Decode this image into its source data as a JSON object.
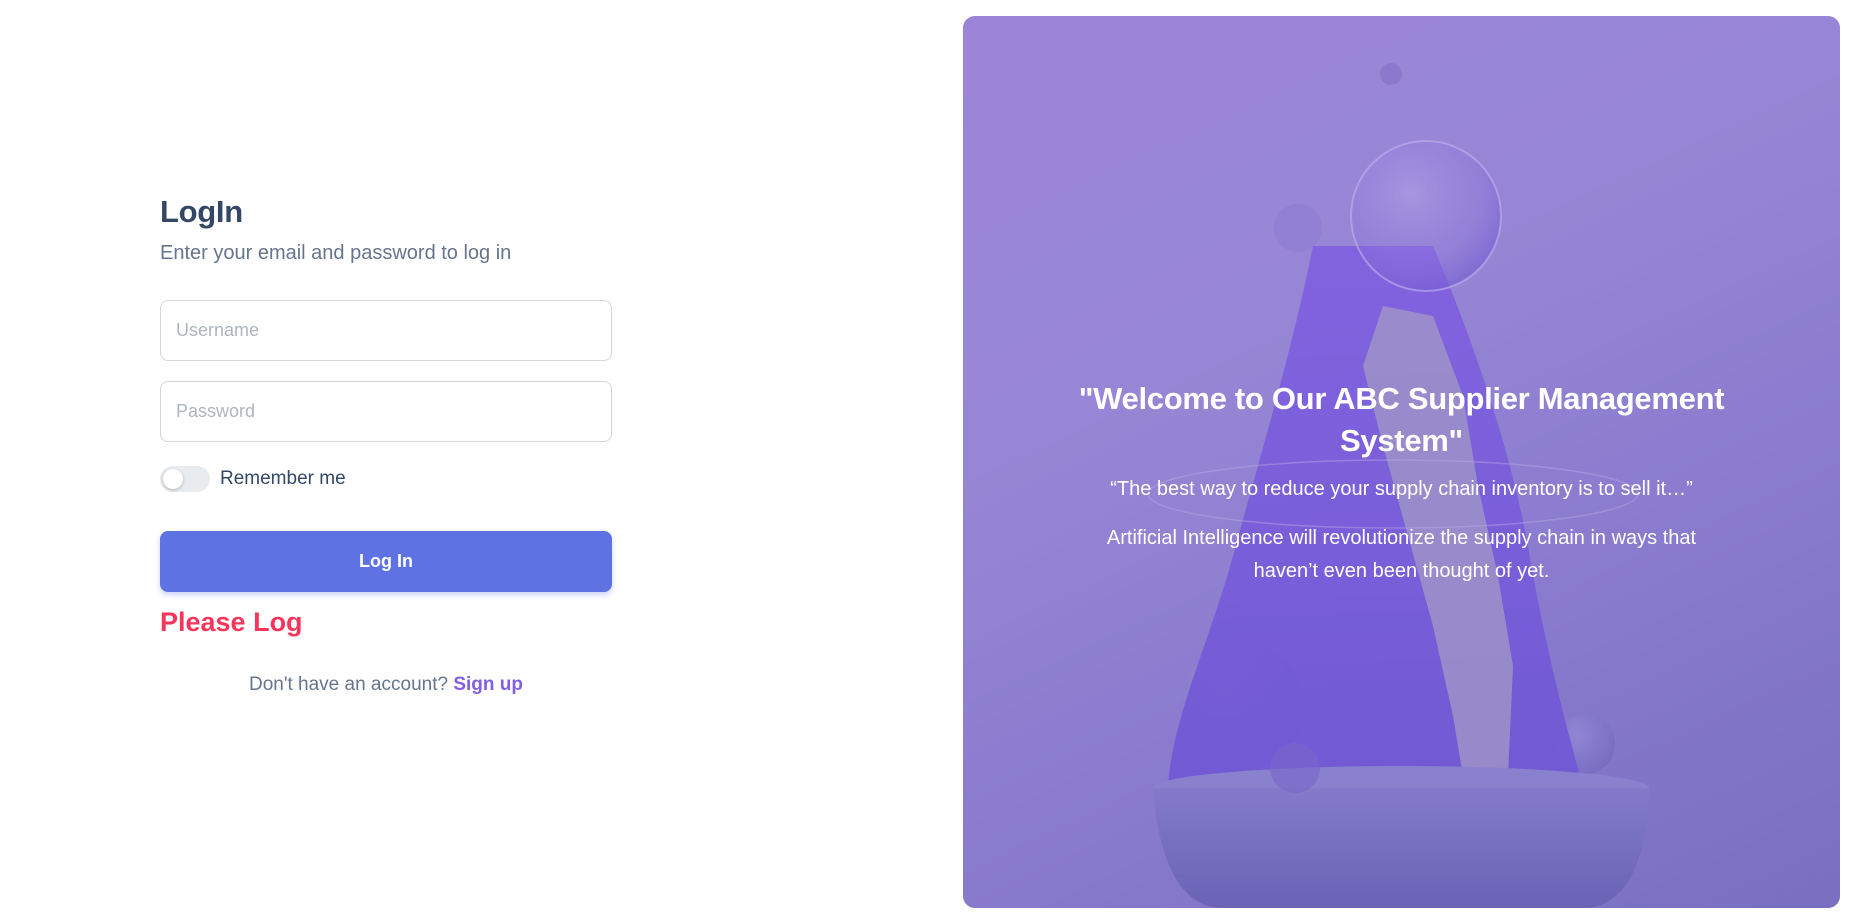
{
  "login": {
    "title": "LogIn",
    "subtitle": "Enter your email and password to log in",
    "username_placeholder": "Username",
    "password_placeholder": "Password",
    "remember_label": "Remember me",
    "remember_checked": false,
    "button_label": "Log In",
    "error_message": "Please Log",
    "signup_prompt": "Don't have an account?",
    "signup_link": "Sign up"
  },
  "hero": {
    "title": "\"Welcome to Our ABC Supplier Management System\"",
    "quote": "“The best way to reduce your supply chain inventory is to sell it…”",
    "description": "Artificial Intelligence will revolutionize the supply chain in ways that haven’t even been thought of yet."
  },
  "colors": {
    "primary": "#5e72e4",
    "heading": "#344767",
    "muted": "#67748e",
    "error": "#f5365c",
    "link": "#825ee4",
    "hero_overlay": "#8e7fd2"
  }
}
